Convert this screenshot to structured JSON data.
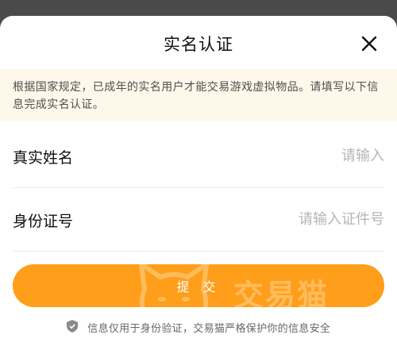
{
  "dialog": {
    "title": "实名认证",
    "close_icon": "close-icon"
  },
  "notice": {
    "text": "根据国家规定，已成年的实名用户才能交易游戏虚拟物品。请填写以下信息完成实名认证。"
  },
  "form": {
    "name": {
      "label": "真实姓名",
      "placeholder": "请输入",
      "value": ""
    },
    "id_number": {
      "label": "身份证号",
      "placeholder": "请输入证件号",
      "value": ""
    }
  },
  "submit": {
    "label": "提 交",
    "watermark_text": "交易猫"
  },
  "footer": {
    "icon": "shield-icon",
    "text": "信息仅用于身份验证，交易猫严格保护你的信息安全"
  },
  "colors": {
    "accent": "#ff9e1b",
    "notice_bg": "#fdf8ea",
    "overlay": "#4a4a4a"
  }
}
